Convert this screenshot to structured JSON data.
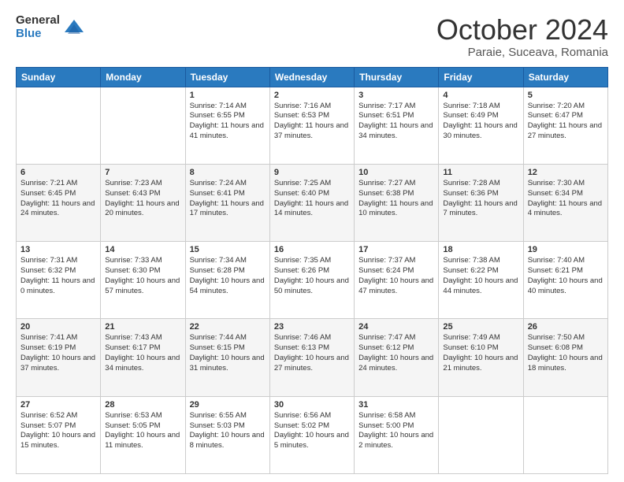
{
  "logo": {
    "general": "General",
    "blue": "Blue"
  },
  "header": {
    "month": "October 2024",
    "location": "Paraie, Suceava, Romania"
  },
  "weekdays": [
    "Sunday",
    "Monday",
    "Tuesday",
    "Wednesday",
    "Thursday",
    "Friday",
    "Saturday"
  ],
  "weeks": [
    [
      {
        "day": "",
        "content": ""
      },
      {
        "day": "",
        "content": ""
      },
      {
        "day": "1",
        "content": "Sunrise: 7:14 AM\nSunset: 6:55 PM\nDaylight: 11 hours and 41 minutes."
      },
      {
        "day": "2",
        "content": "Sunrise: 7:16 AM\nSunset: 6:53 PM\nDaylight: 11 hours and 37 minutes."
      },
      {
        "day": "3",
        "content": "Sunrise: 7:17 AM\nSunset: 6:51 PM\nDaylight: 11 hours and 34 minutes."
      },
      {
        "day": "4",
        "content": "Sunrise: 7:18 AM\nSunset: 6:49 PM\nDaylight: 11 hours and 30 minutes."
      },
      {
        "day": "5",
        "content": "Sunrise: 7:20 AM\nSunset: 6:47 PM\nDaylight: 11 hours and 27 minutes."
      }
    ],
    [
      {
        "day": "6",
        "content": "Sunrise: 7:21 AM\nSunset: 6:45 PM\nDaylight: 11 hours and 24 minutes."
      },
      {
        "day": "7",
        "content": "Sunrise: 7:23 AM\nSunset: 6:43 PM\nDaylight: 11 hours and 20 minutes."
      },
      {
        "day": "8",
        "content": "Sunrise: 7:24 AM\nSunset: 6:41 PM\nDaylight: 11 hours and 17 minutes."
      },
      {
        "day": "9",
        "content": "Sunrise: 7:25 AM\nSunset: 6:40 PM\nDaylight: 11 hours and 14 minutes."
      },
      {
        "day": "10",
        "content": "Sunrise: 7:27 AM\nSunset: 6:38 PM\nDaylight: 11 hours and 10 minutes."
      },
      {
        "day": "11",
        "content": "Sunrise: 7:28 AM\nSunset: 6:36 PM\nDaylight: 11 hours and 7 minutes."
      },
      {
        "day": "12",
        "content": "Sunrise: 7:30 AM\nSunset: 6:34 PM\nDaylight: 11 hours and 4 minutes."
      }
    ],
    [
      {
        "day": "13",
        "content": "Sunrise: 7:31 AM\nSunset: 6:32 PM\nDaylight: 11 hours and 0 minutes."
      },
      {
        "day": "14",
        "content": "Sunrise: 7:33 AM\nSunset: 6:30 PM\nDaylight: 10 hours and 57 minutes."
      },
      {
        "day": "15",
        "content": "Sunrise: 7:34 AM\nSunset: 6:28 PM\nDaylight: 10 hours and 54 minutes."
      },
      {
        "day": "16",
        "content": "Sunrise: 7:35 AM\nSunset: 6:26 PM\nDaylight: 10 hours and 50 minutes."
      },
      {
        "day": "17",
        "content": "Sunrise: 7:37 AM\nSunset: 6:24 PM\nDaylight: 10 hours and 47 minutes."
      },
      {
        "day": "18",
        "content": "Sunrise: 7:38 AM\nSunset: 6:22 PM\nDaylight: 10 hours and 44 minutes."
      },
      {
        "day": "19",
        "content": "Sunrise: 7:40 AM\nSunset: 6:21 PM\nDaylight: 10 hours and 40 minutes."
      }
    ],
    [
      {
        "day": "20",
        "content": "Sunrise: 7:41 AM\nSunset: 6:19 PM\nDaylight: 10 hours and 37 minutes."
      },
      {
        "day": "21",
        "content": "Sunrise: 7:43 AM\nSunset: 6:17 PM\nDaylight: 10 hours and 34 minutes."
      },
      {
        "day": "22",
        "content": "Sunrise: 7:44 AM\nSunset: 6:15 PM\nDaylight: 10 hours and 31 minutes."
      },
      {
        "day": "23",
        "content": "Sunrise: 7:46 AM\nSunset: 6:13 PM\nDaylight: 10 hours and 27 minutes."
      },
      {
        "day": "24",
        "content": "Sunrise: 7:47 AM\nSunset: 6:12 PM\nDaylight: 10 hours and 24 minutes."
      },
      {
        "day": "25",
        "content": "Sunrise: 7:49 AM\nSunset: 6:10 PM\nDaylight: 10 hours and 21 minutes."
      },
      {
        "day": "26",
        "content": "Sunrise: 7:50 AM\nSunset: 6:08 PM\nDaylight: 10 hours and 18 minutes."
      }
    ],
    [
      {
        "day": "27",
        "content": "Sunrise: 6:52 AM\nSunset: 5:07 PM\nDaylight: 10 hours and 15 minutes."
      },
      {
        "day": "28",
        "content": "Sunrise: 6:53 AM\nSunset: 5:05 PM\nDaylight: 10 hours and 11 minutes."
      },
      {
        "day": "29",
        "content": "Sunrise: 6:55 AM\nSunset: 5:03 PM\nDaylight: 10 hours and 8 minutes."
      },
      {
        "day": "30",
        "content": "Sunrise: 6:56 AM\nSunset: 5:02 PM\nDaylight: 10 hours and 5 minutes."
      },
      {
        "day": "31",
        "content": "Sunrise: 6:58 AM\nSunset: 5:00 PM\nDaylight: 10 hours and 2 minutes."
      },
      {
        "day": "",
        "content": ""
      },
      {
        "day": "",
        "content": ""
      }
    ]
  ]
}
